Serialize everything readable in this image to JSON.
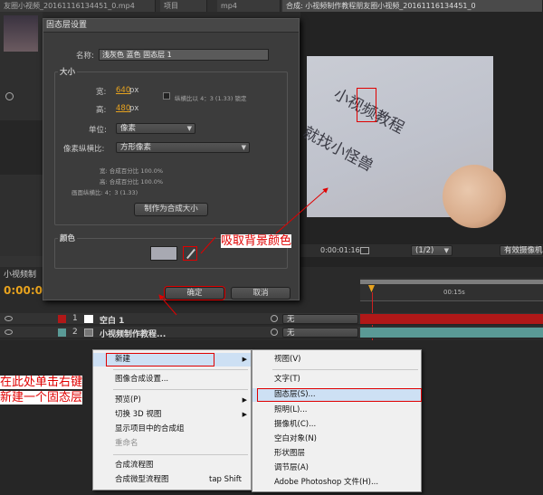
{
  "tabs": [
    "友圈小视频_20161116134451_0.mp4",
    "项目",
    "mp4",
    "合成: 小视频制作教程朋友圈小视频_20161116134451_0"
  ],
  "dialog": {
    "title": "固态层设置",
    "name_label": "名称:",
    "name_value": "浅灰色 蓝色 固态层 1",
    "size_section": "大小",
    "width_label": "宽:",
    "width_value": "640",
    "height_label": "高:",
    "height_value": "480",
    "unit_px": "px",
    "lock_label": "纵横比以 4：3 (1.33) 锁定",
    "units_label": "单位:",
    "units_value": "像素",
    "pixel_aspect_label": "像素纵横比:",
    "pixel_aspect_value": "方形像素",
    "info_width": "宽: 合成百分比 100.0%",
    "info_height": "高: 合成百分比 100.0%",
    "info_frame": "画面纵横比: 4：3 (1.33)",
    "make_comp_size_btn": "制作为合成大小",
    "color_section": "颜色",
    "swatch_color": "#a8a9b2",
    "ok_btn": "确定",
    "cancel_btn": "取消"
  },
  "viewer": {
    "watermark_line1": "小视频教程",
    "watermark_line2": "就找小怪兽",
    "timecode": "0:00:01:16",
    "resolution": "(1/2)",
    "camera": "有效摄像机"
  },
  "timeline": {
    "comp_name": "小视频制",
    "current_time": "0:00:0",
    "time_marker": "00:15s",
    "layers": [
      {
        "num": "1",
        "name": "空白 1",
        "mode": "无",
        "color": "#b01818"
      },
      {
        "num": "2",
        "name": "小视频制作教程...",
        "mode": "无",
        "color": "#5a9a96"
      }
    ]
  },
  "context_menu": {
    "items": [
      "新建",
      "图像合成设置...",
      "预览(P)",
      "切换 3D 视图",
      "显示项目中的合成组",
      "重命名",
      "合成流程图",
      "合成微型流程图"
    ],
    "shortcut": "tap Shift"
  },
  "submenu": {
    "items": [
      "视图(V)",
      "文字(T)",
      "固态层(S)...",
      "照明(L)...",
      "摄像机(C)...",
      "空白对象(N)",
      "形状图层",
      "调节层(A)",
      "Adobe Photoshop 文件(H)..."
    ]
  },
  "annotations": {
    "eyedropper": "吸取背景颜色",
    "right_click_line1": "在此处单击右键",
    "right_click_line2": "新建一个固态层"
  },
  "colors": {
    "accent": "#e8a31e",
    "annotation": "#e00000"
  }
}
